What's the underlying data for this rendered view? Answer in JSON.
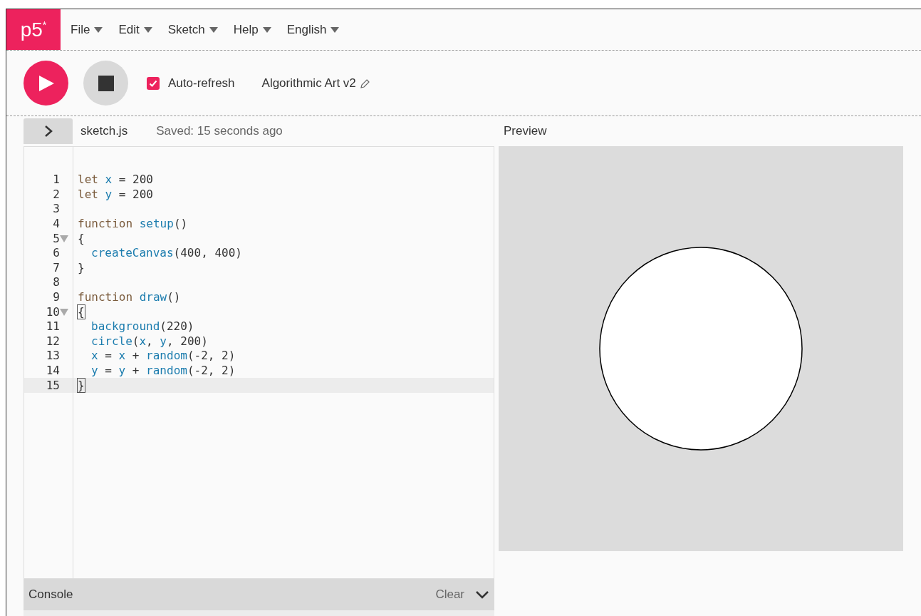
{
  "logo": {
    "text": "p5",
    "mark": "*"
  },
  "menu": [
    {
      "label": "File"
    },
    {
      "label": "Edit"
    },
    {
      "label": "Sketch"
    },
    {
      "label": "Help"
    },
    {
      "label": "English"
    }
  ],
  "toolbar": {
    "auto_refresh": {
      "label": "Auto-refresh",
      "checked": true
    },
    "sketch_name": "Algorithmic Art v2"
  },
  "editor": {
    "file_name": "sketch.js",
    "status": "Saved: 15 seconds ago",
    "lines": [
      {
        "number": "1",
        "fold": false,
        "active": false,
        "indented": false,
        "tokens": [
          {
            "text": "let ",
            "kind": "keyword"
          },
          {
            "text": "x",
            "kind": "name"
          },
          {
            "text": " = 200",
            "kind": "plain"
          }
        ]
      },
      {
        "number": "2",
        "fold": false,
        "active": false,
        "indented": false,
        "tokens": [
          {
            "text": "let ",
            "kind": "keyword"
          },
          {
            "text": "y",
            "kind": "name"
          },
          {
            "text": " = 200",
            "kind": "plain"
          }
        ]
      },
      {
        "number": "3",
        "fold": false,
        "active": false
      },
      {
        "number": "4",
        "fold": false,
        "active": false,
        "indented": false,
        "tokens": [
          {
            "text": "function ",
            "kind": "keyword"
          },
          {
            "text": "setup",
            "kind": "name"
          },
          {
            "text": "()",
            "kind": "plain"
          }
        ]
      },
      {
        "number": "5",
        "fold": true,
        "active": false,
        "indented": false,
        "tokens": [
          {
            "text": "{",
            "kind": "plain"
          }
        ]
      },
      {
        "number": "6",
        "fold": false,
        "active": false,
        "indented": true,
        "tokens": [
          {
            "text": "createCanvas",
            "kind": "name"
          },
          {
            "text": "(400, 400)",
            "kind": "plain"
          }
        ]
      },
      {
        "number": "7",
        "fold": false,
        "active": false,
        "indented": false,
        "tokens": [
          {
            "text": "}",
            "kind": "plain"
          }
        ]
      },
      {
        "number": "8",
        "fold": false,
        "active": false
      },
      {
        "number": "9",
        "fold": false,
        "active": false,
        "indented": false,
        "tokens": [
          {
            "text": "function ",
            "kind": "keyword"
          },
          {
            "text": "draw",
            "kind": "name"
          },
          {
            "text": "()",
            "kind": "plain"
          }
        ]
      },
      {
        "number": "10",
        "fold": true,
        "active": false,
        "indented": false,
        "tokens": [
          {
            "text": "{",
            "kind": "bracket"
          }
        ]
      },
      {
        "number": "11",
        "fold": false,
        "active": false,
        "indented": true,
        "tokens": [
          {
            "text": "background",
            "kind": "name"
          },
          {
            "text": "(220)",
            "kind": "plain"
          }
        ]
      },
      {
        "number": "12",
        "fold": false,
        "active": false,
        "indented": true,
        "tokens": [
          {
            "text": "circle",
            "kind": "name"
          },
          {
            "text": "(",
            "kind": "plain"
          },
          {
            "text": "x",
            "kind": "name"
          },
          {
            "text": ", ",
            "kind": "plain"
          },
          {
            "text": "y",
            "kind": "name"
          },
          {
            "text": ", 200)",
            "kind": "plain"
          }
        ]
      },
      {
        "number": "13",
        "fold": false,
        "active": false,
        "indented": true,
        "tokens": [
          {
            "text": "x",
            "kind": "name"
          },
          {
            "text": " = ",
            "kind": "plain"
          },
          {
            "text": "x",
            "kind": "name"
          },
          {
            "text": " + ",
            "kind": "plain"
          },
          {
            "text": "random",
            "kind": "name"
          },
          {
            "text": "(-2, 2)",
            "kind": "plain"
          }
        ]
      },
      {
        "number": "14",
        "fold": false,
        "active": false,
        "indented": true,
        "tokens": [
          {
            "text": "y",
            "kind": "name"
          },
          {
            "text": " = ",
            "kind": "plain"
          },
          {
            "text": "y",
            "kind": "name"
          },
          {
            "text": " + ",
            "kind": "plain"
          },
          {
            "text": "random",
            "kind": "name"
          },
          {
            "text": "(-2, 2)",
            "kind": "plain"
          }
        ]
      },
      {
        "number": "15",
        "fold": false,
        "active": true,
        "indented": false,
        "tokens": [
          {
            "text": "}",
            "kind": "bracket"
          }
        ]
      }
    ]
  },
  "console": {
    "title": "Console",
    "clear": "Clear"
  },
  "preview": {
    "title": "Preview"
  }
}
